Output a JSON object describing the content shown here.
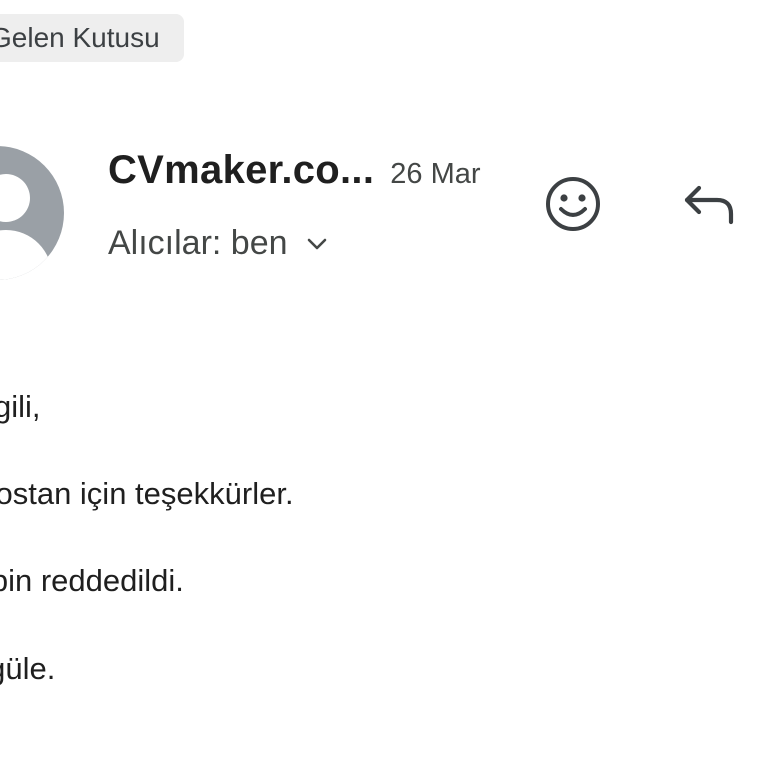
{
  "header": {
    "label_chip": "Gelen Kutusu"
  },
  "message": {
    "sender": "CVmaker.co...",
    "date": "26 Mar",
    "recipients_label": "Alıcılar: ben",
    "body_lines": [
      "İlgilin ilgili,",
      "Yaptostan için teşekkürler.",
      "Talebin reddedildi.",
      "Güle güle."
    ]
  },
  "icons": {
    "avatar": "person-avatar-icon",
    "expand": "chevron-down-icon",
    "react": "smiley-emoji-icon",
    "reply": "reply-arrow-icon"
  },
  "colors": {
    "chip_bg": "#eeeeee",
    "avatar_bg": "#9aa0a6",
    "text_primary": "#1f1f1f",
    "text_secondary": "#444746"
  }
}
